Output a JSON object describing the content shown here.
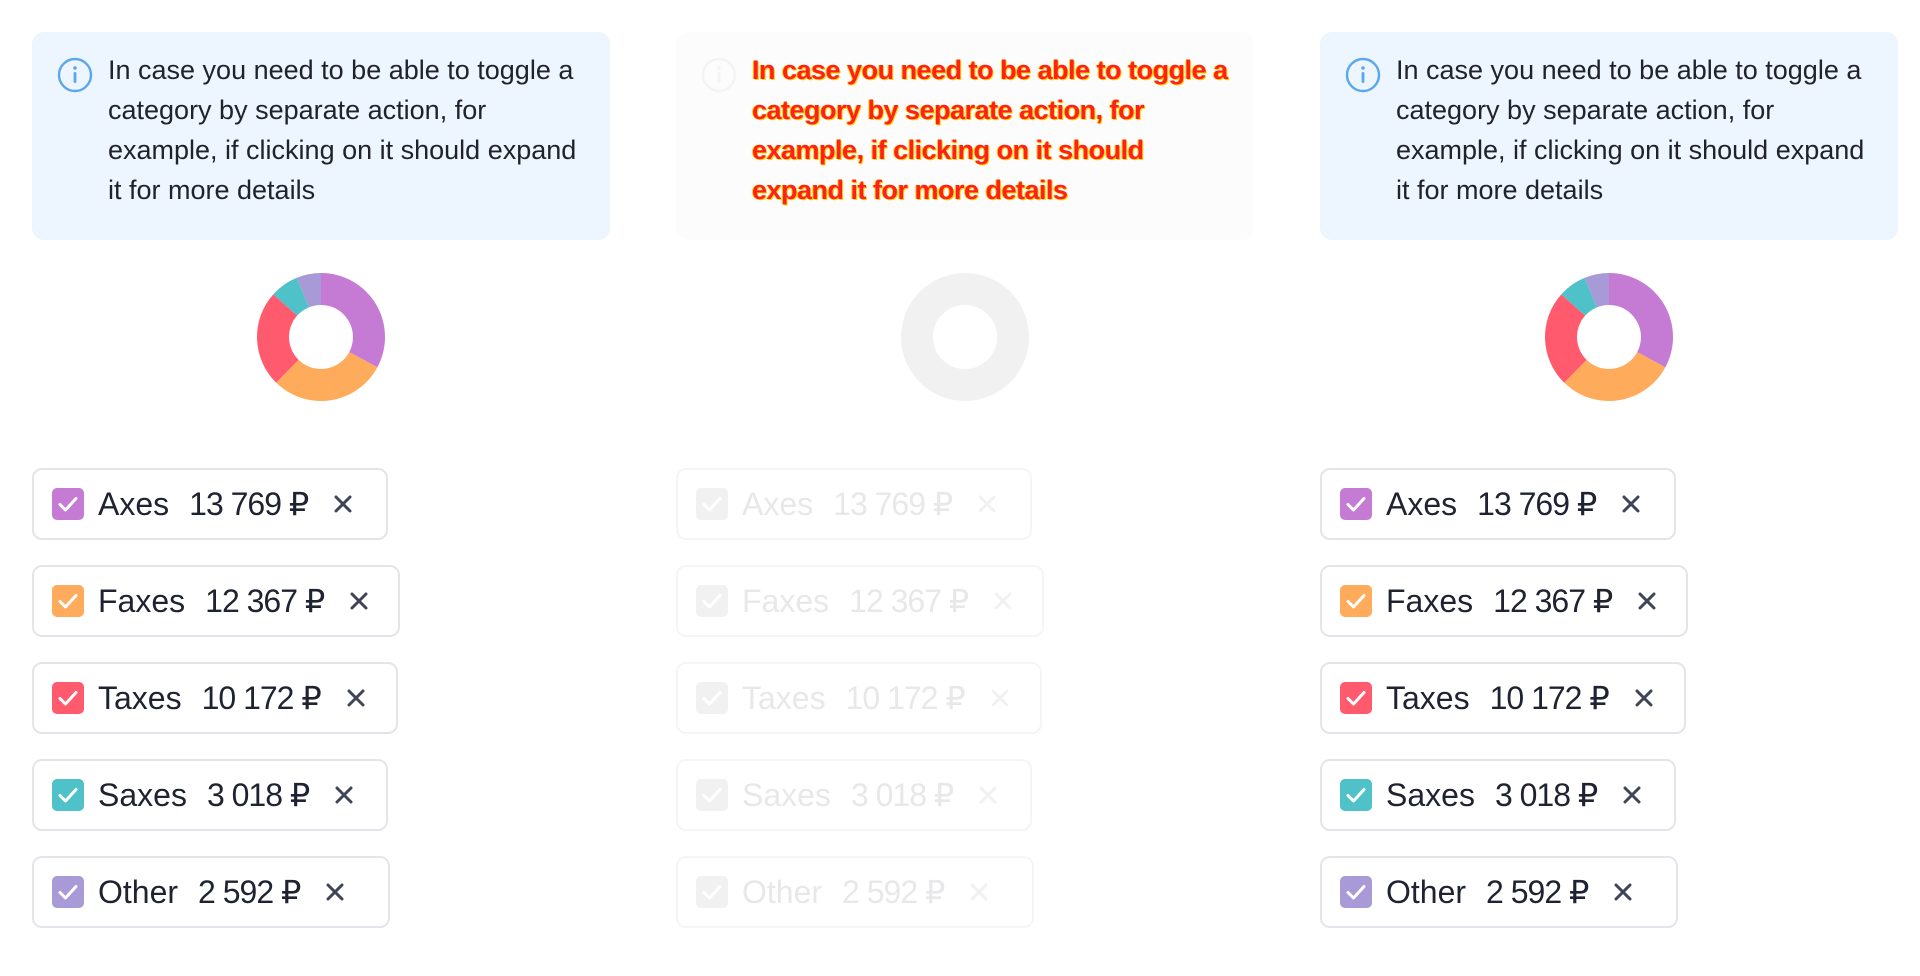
{
  "info_text": "In case you need to be able to toggle a category by separate action, for example, if clicking on it should expand it for more details",
  "categories": [
    {
      "name": "Axes",
      "amount": "13 769 ₽",
      "color": "#c57ad4",
      "value": 13769,
      "checked": true
    },
    {
      "name": "Faxes",
      "amount": "12 367 ₽",
      "color": "#ffab5c",
      "value": 12367,
      "checked": true
    },
    {
      "name": "Taxes",
      "amount": "10 172 ₽",
      "color": "#ff5a6e",
      "value": 10172,
      "checked": true
    },
    {
      "name": "Saxes",
      "amount": "3 018 ₽",
      "color": "#4fc1c8",
      "value": 3018,
      "checked": true
    },
    {
      "name": "Other",
      "amount": "2 592 ₽",
      "color": "#a89ad6",
      "value": 2592,
      "checked": true
    }
  ],
  "panels": [
    {
      "state": "active"
    },
    {
      "state": "disabled"
    },
    {
      "state": "active"
    }
  ],
  "colors": {
    "info_bg": "#edf5fe",
    "info_icon": "#5aa7f0",
    "text": "#20232b",
    "chip_border": "#e3e5ea",
    "close_icon": "#3f4556",
    "disabled_ring": "#f1f1f2",
    "disabled_text": "#e8e8ea"
  }
}
